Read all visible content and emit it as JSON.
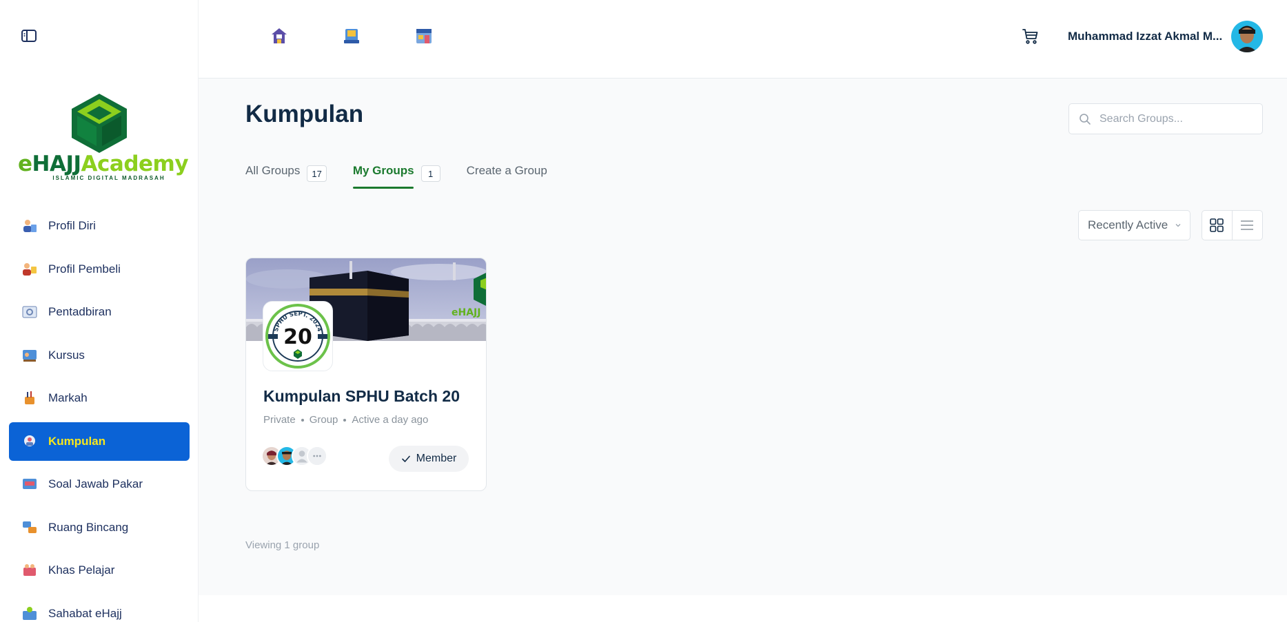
{
  "sidebar": {
    "logo": {
      "prefix": "e",
      "brand": "HAJJ",
      "suffix": "Academy",
      "tagline": "ISLAMIC DIGITAL MADRASAH"
    },
    "items": [
      {
        "label": "Profil Diri",
        "icon": "profile-icon"
      },
      {
        "label": "Profil Pembeli",
        "icon": "buyer-profile-icon"
      },
      {
        "label": "Pentadbiran",
        "icon": "administration-icon"
      },
      {
        "label": "Kursus",
        "icon": "course-icon"
      },
      {
        "label": "Markah",
        "icon": "grades-icon"
      },
      {
        "label": "Kumpulan",
        "icon": "group-icon",
        "active": true
      },
      {
        "label": "Soal Jawab Pakar",
        "icon": "expert-qa-icon"
      },
      {
        "label": "Ruang Bincang",
        "icon": "discussion-icon"
      },
      {
        "label": "Khas Pelajar",
        "icon": "student-icon"
      },
      {
        "label": "Sahabat eHajj",
        "icon": "friends-icon"
      }
    ]
  },
  "header": {
    "user_name": "Muhammad Izzat Akmal M...",
    "icons": [
      "home-icon",
      "book-icon",
      "store-icon",
      "cart-icon"
    ]
  },
  "main": {
    "title": "Kumpulan",
    "search_placeholder": "Search Groups...",
    "tabs": [
      {
        "label": "All Groups",
        "count": "17"
      },
      {
        "label": "My Groups",
        "count": "1",
        "active": true
      },
      {
        "label": "Create a Group"
      }
    ],
    "sort_label": "Recently Active",
    "viewing_text": "Viewing 1 group"
  },
  "card": {
    "title": "Kumpulan SPHU Batch 20",
    "privacy": "Private",
    "type": "Group",
    "activity": "Active a day ago",
    "badge_top": "SPHU SEPT. 2024",
    "badge_number": "20",
    "cover_brand": "eHAJJ",
    "member_button": "Member"
  },
  "colors": {
    "accent_blue": "#0b63d6",
    "active_label": "#f8e71c",
    "tab_green": "#1b7a2e",
    "text_dark": "#122b46"
  }
}
